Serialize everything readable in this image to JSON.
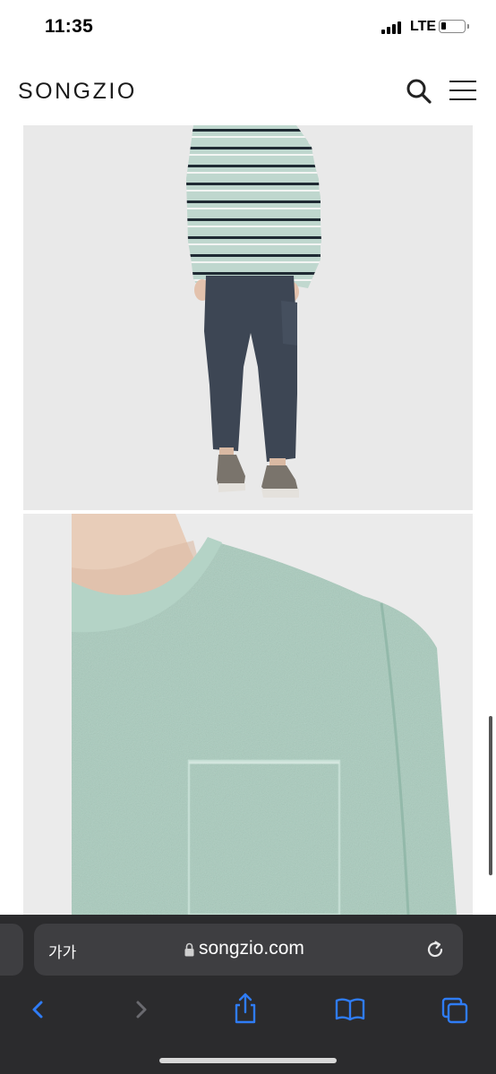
{
  "status_bar": {
    "time": "11:35",
    "network": "LTE"
  },
  "header": {
    "logo": "SONGZIO",
    "search_icon": "search-icon",
    "menu_icon": "hamburger-menu-icon"
  },
  "product_images": [
    {
      "name": "full-outfit-photo",
      "description_colors": {
        "sweater": "#bcd5cc",
        "stripe": "#1f2a33",
        "pants": "#3d4654",
        "shoes": "#7a746c"
      }
    },
    {
      "name": "sweater-closeup-photo",
      "description_colors": {
        "sweater": "#a8cbbd"
      }
    }
  ],
  "browser": {
    "text_size_label": "가가",
    "url": "songzio.com",
    "bar_color": "#2b2b2d",
    "accent": "#2f7cf6",
    "toolbar_icons": [
      "back-icon",
      "forward-icon",
      "share-icon",
      "bookmarks-icon",
      "tabs-icon"
    ]
  }
}
